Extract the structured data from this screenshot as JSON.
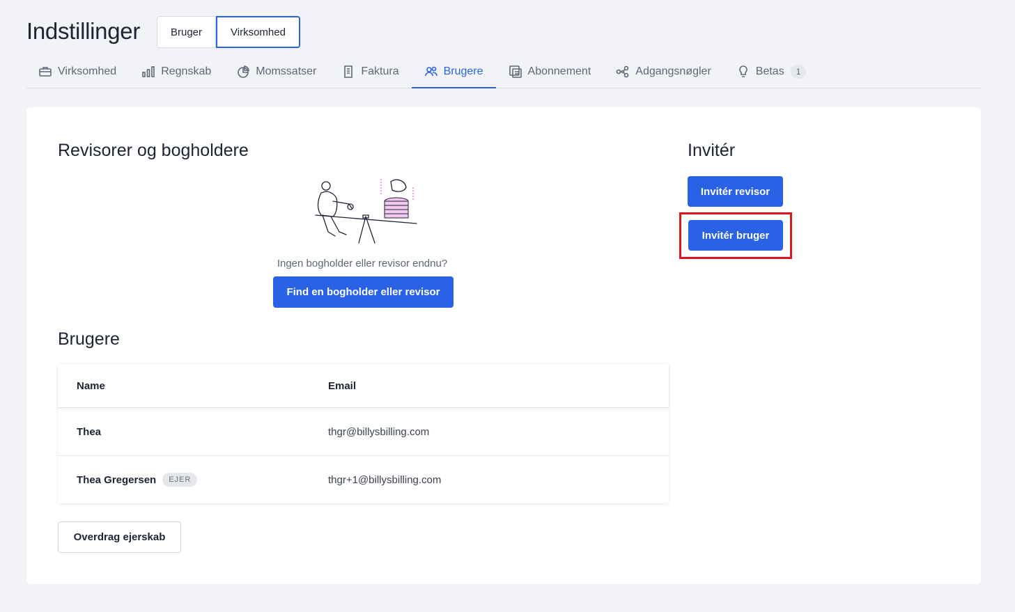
{
  "page": {
    "title": "Indstillinger",
    "scope_toggle": {
      "user_label": "Bruger",
      "company_label": "Virksomhed",
      "selected": "Virksomhed"
    }
  },
  "tabs": [
    {
      "label": "Virksomhed",
      "icon": "briefcase-icon"
    },
    {
      "label": "Regnskab",
      "icon": "bar-chart-icon"
    },
    {
      "label": "Momssatser",
      "icon": "pie-chart-icon"
    },
    {
      "label": "Faktura",
      "icon": "document-icon"
    },
    {
      "label": "Brugere",
      "icon": "users-icon",
      "active": true
    },
    {
      "label": "Abonnement",
      "icon": "copy-icon"
    },
    {
      "label": "Adgangsnøgler",
      "icon": "share-nodes-icon"
    },
    {
      "label": "Betas",
      "icon": "lightbulb-icon",
      "badge": "1"
    }
  ],
  "accountants": {
    "heading": "Revisorer og bogholdere",
    "empty_text": "Ingen bogholder eller revisor endnu?",
    "find_button": "Find en bogholder eller revisor"
  },
  "invite": {
    "heading": "Invitér",
    "invite_accountant": "Invitér revisor",
    "invite_user": "Invitér bruger"
  },
  "users": {
    "heading": "Brugere",
    "columns": {
      "name": "Name",
      "email": "Email"
    },
    "rows": [
      {
        "name": "Thea",
        "email": "thgr@billysbilling.com",
        "badge": ""
      },
      {
        "name": "Thea Gregersen",
        "email": "thgr+1@billysbilling.com",
        "badge": "EJER"
      }
    ],
    "transfer_button": "Overdrag ejerskab"
  },
  "colors": {
    "accent": "#2a62e6",
    "highlight": "#e0141b",
    "background": "#f1f3f7"
  }
}
